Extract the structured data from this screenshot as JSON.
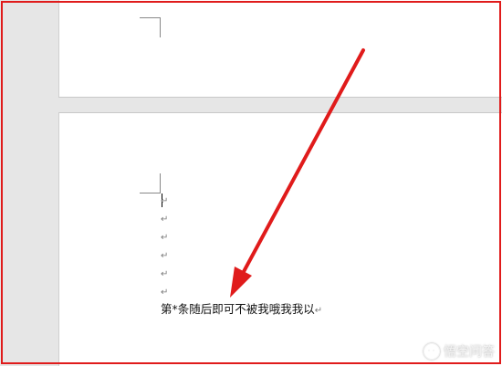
{
  "document": {
    "empty_paragraph_marks": [
      "↵",
      "↵",
      "↵",
      "↵",
      "↵",
      "↵"
    ],
    "text_line": "第*条随后即可不被我哦我我以",
    "text_line_end_mark": "↵"
  },
  "annotation": {
    "arrow_color": "#e01b1b",
    "frame_color": "#e01b1b"
  },
  "watermark": {
    "text": "悟空问答",
    "icon": "speech-bubble-icon"
  }
}
